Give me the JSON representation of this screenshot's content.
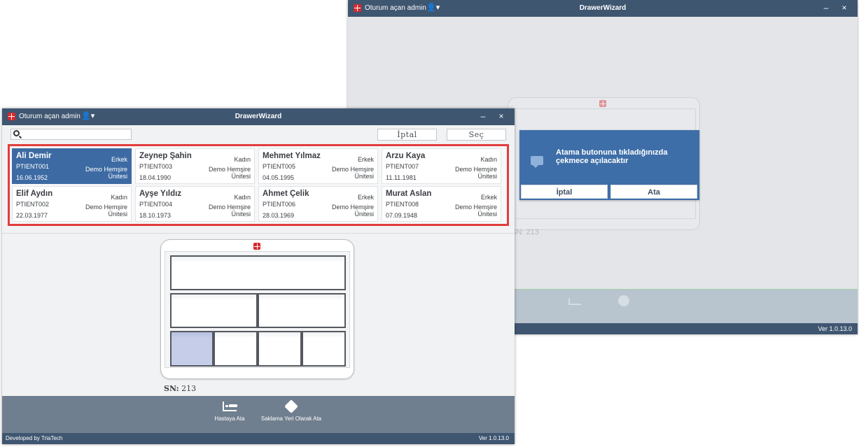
{
  "back_window": {
    "user_label": "Oturum açan admin",
    "title": "DrawerWizard",
    "minimize": "–",
    "close": "×",
    "dialog": {
      "message": "Atama butonuna tıkladığınızda çekmece açılacaktır",
      "cancel_label": "İptal",
      "assign_label": "Ata"
    },
    "sn_label": "SN:",
    "sn_value": "213",
    "version": "Ver 1.0.13.0"
  },
  "front_window": {
    "user_label": "Oturum açan admin",
    "title": "DrawerWizard",
    "minimize": "–",
    "close": "×",
    "search": {
      "value": "",
      "placeholder": ""
    },
    "cancel_label": "İptal",
    "select_label": "Seç",
    "patients": [
      {
        "name": "Ali Demir",
        "id": "PTIENT001",
        "date": "16.06.1952",
        "gender": "Erkek",
        "unit1": "Demo Hemşire",
        "unit2": "Ünitesi",
        "selected": true
      },
      {
        "name": "Zeynep Şahin",
        "id": "PTIENT003",
        "date": "18.04.1990",
        "gender": "Kadın",
        "unit1": "Demo Hemşire",
        "unit2": "Ünitesi",
        "selected": false
      },
      {
        "name": "Mehmet Yılmaz",
        "id": "PTIENT005",
        "date": "04.05.1995",
        "gender": "Erkek",
        "unit1": "Demo Hemşire",
        "unit2": "Ünitesi",
        "selected": false
      },
      {
        "name": "Arzu Kaya",
        "id": "PTIENT007",
        "date": "11.11.1981",
        "gender": "Kadın",
        "unit1": "Demo Hemşire",
        "unit2": "Ünitesi",
        "selected": false
      },
      {
        "name": "Elif Aydın",
        "id": "PTIENT002",
        "date": "22.03.1977",
        "gender": "Kadın",
        "unit1": "Demo Hemşire",
        "unit2": "Ünitesi",
        "selected": false
      },
      {
        "name": "Ayşe Yıldız",
        "id": "PTIENT004",
        "date": "18.10.1973",
        "gender": "Kadın",
        "unit1": "Demo Hemşire",
        "unit2": "Ünitesi",
        "selected": false
      },
      {
        "name": "Ahmet Çelik",
        "id": "PTIENT006",
        "date": "28.03.1969",
        "gender": "Erkek",
        "unit1": "Demo Hemşire",
        "unit2": "Ünitesi",
        "selected": false
      },
      {
        "name": "Murat Aslan",
        "id": "PTIENT008",
        "date": "07.09.1948",
        "gender": "Erkek",
        "unit1": "Demo Hemşire",
        "unit2": "Ünitesi",
        "selected": false
      }
    ],
    "sn_label": "SN:",
    "sn_value": "213",
    "actions": {
      "assign_patient": "Hastaya Ata",
      "assign_storage": "Saklama Yeri Olarak Ata"
    },
    "developer": "Developed by TriaTech",
    "version": "Ver 1.0.13.0"
  },
  "colors": {
    "titlebar": "#3f5671",
    "accent": "#3d6aa3",
    "highlight_border": "#e23d3d",
    "brand_logo": "#d6292d"
  }
}
